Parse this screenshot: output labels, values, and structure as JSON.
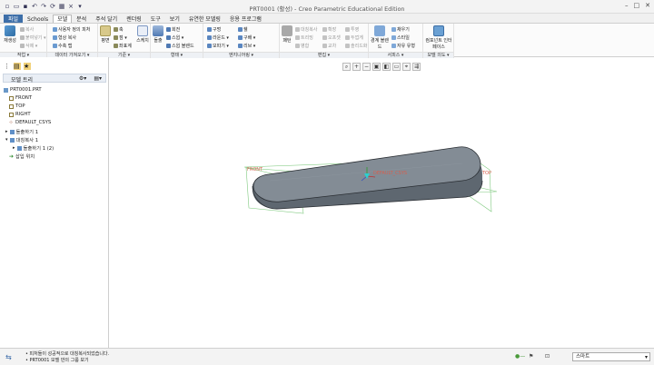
{
  "window": {
    "title": "PRT0001 (활성) - Creo Parametric Educational Edition"
  },
  "tabs": [
    {
      "label": "파일"
    },
    {
      "label": "Schools"
    },
    {
      "label": "모델"
    },
    {
      "label": "분석"
    },
    {
      "label": "주석 달기"
    },
    {
      "label": "렌더링"
    },
    {
      "label": "도구"
    },
    {
      "label": "보기"
    },
    {
      "label": "유연한 모델링"
    },
    {
      "label": "응용 프로그램"
    }
  ],
  "ribbon": {
    "groups": [
      {
        "label": "작업 ▾"
      },
      {
        "label": "데이터 가져오기 ▾"
      },
      {
        "label": "기준 ▾"
      },
      {
        "label": "형태 ▾"
      },
      {
        "label": "엔지니어링 ▾"
      },
      {
        "label": "편집 ▾"
      },
      {
        "label": "서피스 ▾"
      },
      {
        "label": "모델 의도 ▾"
      }
    ],
    "ops": {
      "regen": "재생성",
      "copy": "복사",
      "paste": "붙여넣기 ▾",
      "delete": "삭제 ▾"
    },
    "import": {
      "udf": "사용자 정의 피처",
      "copy_geom": "형상 복사",
      "shrinkwrap": "수축 랩"
    },
    "datum": {
      "plane": "평면",
      "axis": "축",
      "point": "점 ▾",
      "csys": "좌표계",
      "sketch": "스케치"
    },
    "shapes": {
      "extrude": "돌출",
      "revolve": "회전",
      "sweep": "스윕 ▾",
      "swept_blend": "스윕 블렌드"
    },
    "engineering": {
      "hole": "구멍",
      "round": "라운드 ▾",
      "chamfer": "모따기 ▾",
      "shell": "쉘",
      "draft": "구배 ▾",
      "rib": "리브 ▾"
    },
    "editing": {
      "pattern": "패턴",
      "mirror": "대칭복사",
      "trim": "트리밍",
      "merge": "병합",
      "extend": "확장",
      "offset": "오프셋",
      "intersect": "교차",
      "project": "투영",
      "thicken": "두껍게",
      "solidify": "솔리드화"
    },
    "surfaces": {
      "boundary_blend": "경계 블렌드",
      "fill": "채우기",
      "style": "스타일",
      "freestyle": "자유 유형"
    },
    "intent": {
      "component_interface": "컴포넌트 인터페이스"
    }
  },
  "model_tree": {
    "header": "모델 트리",
    "items": [
      {
        "label": "PRT0001.PRT",
        "icon": "part-icon"
      },
      {
        "label": "FRONT",
        "icon": "datum-plane-icon"
      },
      {
        "label": "TOP",
        "icon": "datum-plane-icon"
      },
      {
        "label": "RIGHT",
        "icon": "datum-plane-icon"
      },
      {
        "label": "DEFAULT_CSYS",
        "icon": "csys-icon"
      },
      {
        "label": "돌출하기 1",
        "icon": "extrude-icon"
      },
      {
        "label": "대칭복사 1",
        "icon": "mirror-icon"
      },
      {
        "label": "돌출하기 1 (2)",
        "icon": "extrude-icon"
      },
      {
        "label": "삽입 위치",
        "icon": "insert-icon"
      }
    ]
  },
  "canvas": {
    "labels": {
      "front": "FRONT",
      "top": "TOP",
      "csys": "DEFAULT_CSYS"
    },
    "part_color": "#7b8590"
  },
  "status": {
    "messages": [
      "• 피처들이 성공적으로 대칭복사되었습니다.",
      "• PRT0001 모델 만의 그룹 보기"
    ],
    "filter": "스마트"
  }
}
